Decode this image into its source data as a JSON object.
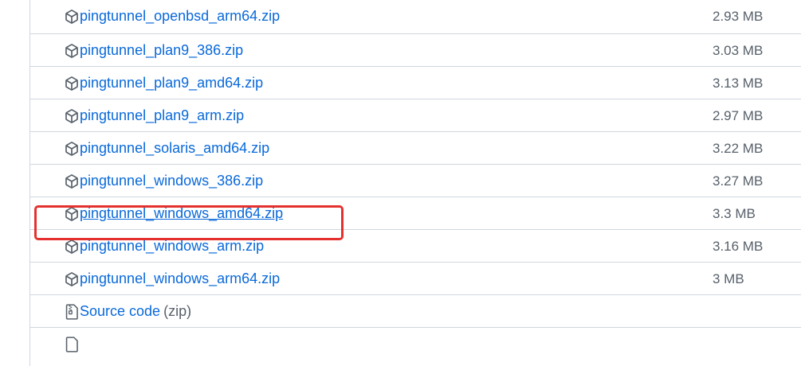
{
  "assets": [
    {
      "name": "pingtunnel_openbsd_arm64.zip",
      "size": "2.93 MB"
    },
    {
      "name": "pingtunnel_plan9_386.zip",
      "size": "3.03 MB"
    },
    {
      "name": "pingtunnel_plan9_amd64.zip",
      "size": "3.13 MB"
    },
    {
      "name": "pingtunnel_plan9_arm.zip",
      "size": "2.97 MB"
    },
    {
      "name": "pingtunnel_solaris_amd64.zip",
      "size": "3.22 MB"
    },
    {
      "name": "pingtunnel_windows_386.zip",
      "size": "3.27 MB"
    },
    {
      "name": "pingtunnel_windows_amd64.zip",
      "size": "3.3 MB"
    },
    {
      "name": "pingtunnel_windows_arm.zip",
      "size": "3.16 MB"
    },
    {
      "name": "pingtunnel_windows_arm64.zip",
      "size": "3 MB"
    }
  ],
  "source_code": {
    "label": "Source code",
    "suffix": "(zip)"
  },
  "colors": {
    "link": "#0969da",
    "muted": "#57606a",
    "border": "#d0d7de",
    "highlight": "#e5312e"
  },
  "icons": {
    "asset": "package-icon",
    "source": "file-zip-icon"
  }
}
